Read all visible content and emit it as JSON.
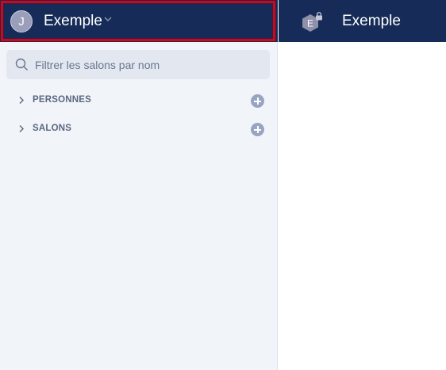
{
  "account": {
    "avatar_letter": "J",
    "name": "Exemple"
  },
  "search": {
    "placeholder": "Filtrer les salons par nom",
    "value": ""
  },
  "sections": [
    {
      "label": "PERSONNES"
    },
    {
      "label": "SALONS"
    }
  ],
  "room": {
    "avatar_letter": "E",
    "title": "Exemple"
  },
  "colors": {
    "header_bg": "#162b57",
    "sidebar_bg": "#f1f4f8",
    "highlight": "#e2000f",
    "add_button": "#98a5c2"
  }
}
